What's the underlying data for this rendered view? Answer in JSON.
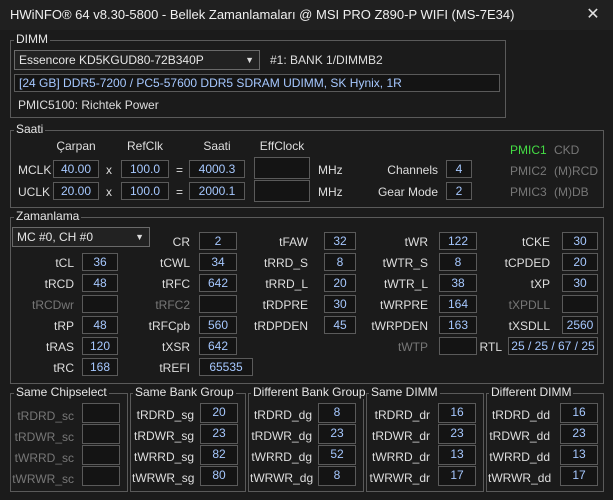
{
  "window": {
    "title": "HWiNFO® 64 v8.30-5800 - Bellek Zamanlamaları @ MSI PRO Z890-P WIFI (MS-7E34)",
    "close": "✕"
  },
  "dimm": {
    "title": "DIMM",
    "module_select": "Essencore KD5KGUD80-72B340P",
    "bank": "#1: BANK 1/DIMMB2",
    "info": "[24 GB] DDR5-7200 / PC5-57600 DDR5 SDRAM UDIMM, SK Hynix, 1R",
    "pmic": "PMIC5100: Richtek Power"
  },
  "saati": {
    "title": "Saati",
    "headers": {
      "carpan": "Çarpan",
      "refclk": "RefClk",
      "saati": "Saati",
      "effclock": "EffClock"
    },
    "mclk": {
      "label": "MCLK",
      "mult": "40.00",
      "x": "x",
      "ref": "100.0",
      "eq": "=",
      "freq": "4000.3",
      "unit": "MHz"
    },
    "uclk": {
      "label": "UCLK",
      "mult": "20.00",
      "x": "x",
      "ref": "100.0",
      "eq": "=",
      "freq": "2000.1",
      "unit": "MHz"
    },
    "channels_label": "Channels",
    "channels": "4",
    "gear_label": "Gear Mode",
    "gear": "2",
    "pmic1": "PMIC1",
    "pmic2": "PMIC2",
    "pmic3": "PMIC3",
    "ckd": "CKD",
    "mrcd": "(M)RCD",
    "mdb": "(M)DB"
  },
  "zamanlama": {
    "title": "Zamanlama",
    "channel_select": "MC #0, CH #0",
    "cr": {
      "label": "CR",
      "value": "2"
    },
    "tfaw": {
      "label": "tFAW",
      "value": "32"
    },
    "twr": {
      "label": "tWR",
      "value": "122"
    },
    "tcke": {
      "label": "tCKE",
      "value": "30"
    },
    "tcl": {
      "label": "tCL",
      "value": "36"
    },
    "tcwl": {
      "label": "tCWL",
      "value": "34"
    },
    "trrd_s": {
      "label": "tRRD_S",
      "value": "8"
    },
    "twtr_s": {
      "label": "tWTR_S",
      "value": "8"
    },
    "tcpded": {
      "label": "tCPDED",
      "value": "20"
    },
    "trcd": {
      "label": "tRCD",
      "value": "48"
    },
    "trfc": {
      "label": "tRFC",
      "value": "642"
    },
    "trrd_l": {
      "label": "tRRD_L",
      "value": "20"
    },
    "twtr_l": {
      "label": "tWTR_L",
      "value": "38"
    },
    "txp": {
      "label": "tXP",
      "value": "30"
    },
    "trcdwr": {
      "label": "tRCDwr",
      "value": ""
    },
    "trfc2": {
      "label": "tRFC2",
      "value": ""
    },
    "trdpre": {
      "label": "tRDPRE",
      "value": "30"
    },
    "twrpre": {
      "label": "tWRPRE",
      "value": "164"
    },
    "txpdll": {
      "label": "tXPDLL",
      "value": ""
    },
    "trp": {
      "label": "tRP",
      "value": "48"
    },
    "trfcpb": {
      "label": "tRFCpb",
      "value": "560"
    },
    "trdpden": {
      "label": "tRDPDEN",
      "value": "45"
    },
    "twrpden": {
      "label": "tWRPDEN",
      "value": "163"
    },
    "txsdll": {
      "label": "tXSDLL",
      "value": "2560"
    },
    "tras": {
      "label": "tRAS",
      "value": "120"
    },
    "txsr": {
      "label": "tXSR",
      "value": "642"
    },
    "twtp": {
      "label": "tWTP",
      "value": ""
    },
    "rtl": {
      "label": "RTL",
      "value": "25 / 25 / 67 / 25"
    },
    "trc": {
      "label": "tRC",
      "value": "168"
    },
    "trefi": {
      "label": "tREFI",
      "value": "65535"
    }
  },
  "sections": {
    "same_cs": {
      "title": "Same Chipselect",
      "rows": [
        {
          "label": "tRDRD_sc",
          "value": ""
        },
        {
          "label": "tRDWR_sc",
          "value": ""
        },
        {
          "label": "tWRRD_sc",
          "value": ""
        },
        {
          "label": "tWRWR_sc",
          "value": ""
        }
      ]
    },
    "same_bg": {
      "title": "Same Bank Group",
      "rows": [
        {
          "label": "tRDRD_sg",
          "value": "20"
        },
        {
          "label": "tRDWR_sg",
          "value": "23"
        },
        {
          "label": "tWRRD_sg",
          "value": "82"
        },
        {
          "label": "tWRWR_sg",
          "value": "80"
        }
      ]
    },
    "diff_bg": {
      "title": "Different Bank Group",
      "rows": [
        {
          "label": "tRDRD_dg",
          "value": "8"
        },
        {
          "label": "tRDWR_dg",
          "value": "23"
        },
        {
          "label": "tWRRD_dg",
          "value": "52"
        },
        {
          "label": "tWRWR_dg",
          "value": "8"
        }
      ]
    },
    "same_dimm": {
      "title": "Same DIMM",
      "rows": [
        {
          "label": "tRDRD_dr",
          "value": "16"
        },
        {
          "label": "tRDWR_dr",
          "value": "23"
        },
        {
          "label": "tWRRD_dr",
          "value": "13"
        },
        {
          "label": "tWRWR_dr",
          "value": "17"
        }
      ]
    },
    "diff_dimm": {
      "title": "Different DIMM",
      "rows": [
        {
          "label": "tRDRD_dd",
          "value": "16"
        },
        {
          "label": "tRDWR_dd",
          "value": "23"
        },
        {
          "label": "tWRRD_dd",
          "value": "13"
        },
        {
          "label": "tWRWR_dd",
          "value": "17"
        }
      ]
    }
  },
  "colors": {
    "value_text": "#a6c8ff",
    "pmic1_active": "#44dd44",
    "disabled_text": "#777777"
  }
}
